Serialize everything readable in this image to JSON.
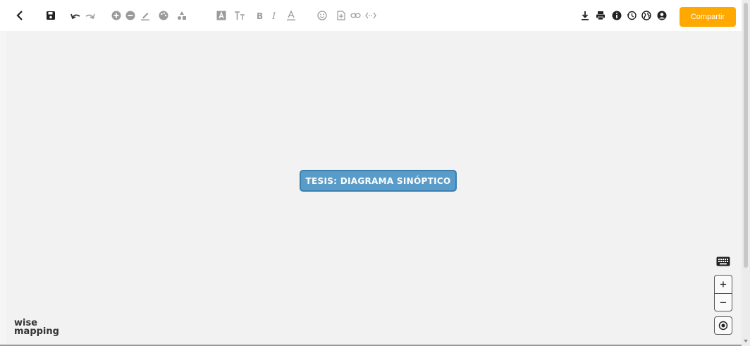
{
  "toolbar": {
    "share_label": "Compartir",
    "colors": {
      "accent": "#ffa800",
      "icon_dark": "#222222",
      "icon_gray": "#9a9a9a"
    }
  },
  "canvas": {
    "central_topic": {
      "label": "TESIS: DIAGRAMA SINÓPTICO",
      "fill_color": "#5a9cc9",
      "border_color": "#3a7fb0"
    }
  },
  "logo": {
    "line1": "wise",
    "line2": "mapping"
  },
  "zoom_controls": {
    "zoom_in": "+",
    "zoom_out": "−"
  }
}
